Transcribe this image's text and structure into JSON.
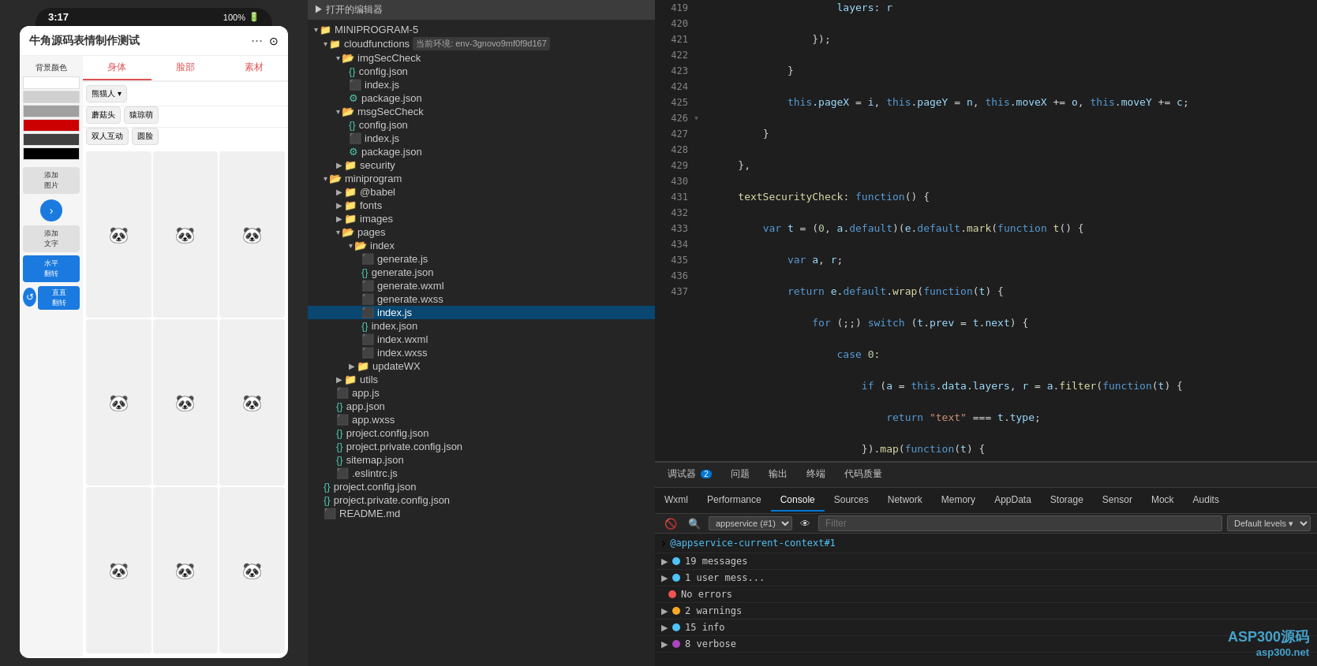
{
  "app": {
    "title": "牛角源码表情制作测试",
    "status_time": "3:17",
    "battery": "100%"
  },
  "phone": {
    "header_title": "牛角源码表情制作测试",
    "dots": "···",
    "record_icon": "⊙",
    "tabs": [
      "身体",
      "脸部",
      "素材"
    ],
    "bg_color_label": "背景颜色",
    "action_btns": [
      "添加图片",
      "添加文字",
      "水平翻转",
      "直直翻转"
    ],
    "dropdown_items": [
      "熊猫人",
      "蘑菇头",
      "猿琼萌",
      "双人互动",
      "圆脸"
    ]
  },
  "file_tree": {
    "open_editor_label": "▶ 打开的编辑器",
    "project_name": "MINIPROGRAM-5",
    "cloudfunctions_label": "cloudfunctions",
    "cloud_env": "当前环境: env-3gnovo9mf0f9d167",
    "items": [
      {
        "name": "imgSecCheck",
        "type": "folder",
        "indent": 2
      },
      {
        "name": "config.json",
        "type": "json",
        "indent": 3
      },
      {
        "name": "index.js",
        "type": "js",
        "indent": 3
      },
      {
        "name": "package.json",
        "type": "json",
        "indent": 3
      },
      {
        "name": "msgSecCheck",
        "type": "folder",
        "indent": 2
      },
      {
        "name": "config.json",
        "type": "json",
        "indent": 3
      },
      {
        "name": "index.js",
        "type": "js",
        "indent": 3
      },
      {
        "name": "package.json",
        "type": "json",
        "indent": 3
      },
      {
        "name": "security",
        "type": "folder",
        "indent": 2
      },
      {
        "name": "miniprogram",
        "type": "folder",
        "indent": 1
      },
      {
        "name": "@babel",
        "type": "folder",
        "indent": 2
      },
      {
        "name": "fonts",
        "type": "folder",
        "indent": 2
      },
      {
        "name": "images",
        "type": "folder",
        "indent": 2
      },
      {
        "name": "pages",
        "type": "folder",
        "indent": 2
      },
      {
        "name": "index",
        "type": "folder",
        "indent": 3
      },
      {
        "name": "generate.js",
        "type": "js",
        "indent": 4
      },
      {
        "name": "generate.json",
        "type": "json",
        "indent": 4
      },
      {
        "name": "generate.wxml",
        "type": "wxml",
        "indent": 4
      },
      {
        "name": "generate.wxss",
        "type": "wxss",
        "indent": 4
      },
      {
        "name": "index.js",
        "type": "js",
        "indent": 4,
        "active": true
      },
      {
        "name": "index.json",
        "type": "json",
        "indent": 4
      },
      {
        "name": "index.wxml",
        "type": "wxml",
        "indent": 4
      },
      {
        "name": "index.wxss",
        "type": "wxss",
        "indent": 4
      },
      {
        "name": "updateWX",
        "type": "folder",
        "indent": 3
      },
      {
        "name": "utils",
        "type": "folder",
        "indent": 2
      },
      {
        "name": "app.js",
        "type": "js",
        "indent": 1
      },
      {
        "name": "app.json",
        "type": "json",
        "indent": 1
      },
      {
        "name": "app.wxss",
        "type": "wxss",
        "indent": 1
      },
      {
        "name": "project.config.json",
        "type": "json",
        "indent": 1
      },
      {
        "name": "project.private.config.json",
        "type": "json",
        "indent": 1
      },
      {
        "name": "sitemap.json",
        "type": "json",
        "indent": 1
      },
      {
        "name": ".eslintrc.js",
        "type": "js_dot",
        "indent": 1
      },
      {
        "name": "project.config.json",
        "type": "json",
        "indent": 0
      },
      {
        "name": "project.private.config.json",
        "type": "json",
        "indent": 0
      },
      {
        "name": "README.md",
        "type": "md",
        "indent": 0
      }
    ]
  },
  "code": {
    "lines": [
      419,
      420,
      421,
      422,
      423,
      424,
      425,
      426,
      427,
      428,
      429,
      430,
      431,
      432,
      433,
      434,
      435,
      436,
      437
    ]
  },
  "console": {
    "tabs": [
      {
        "label": "调试器",
        "badge": "2",
        "active": false
      },
      {
        "label": "问题",
        "badge": "",
        "active": false
      },
      {
        "label": "输出",
        "badge": "",
        "active": false
      },
      {
        "label": "终端",
        "badge": "",
        "active": false
      },
      {
        "label": "代码质量",
        "badge": "",
        "active": false
      }
    ],
    "tab_items": [
      "Wxml",
      "Performance",
      "Console",
      "Sources",
      "Network",
      "Memory",
      "AppData",
      "Storage",
      "Sensor",
      "Mock",
      "Audits"
    ],
    "active_tab": "Console",
    "context": "appservice (#1)",
    "filter_placeholder": "Filter",
    "levels": "Default levels",
    "link": "@appservice-current-context#1",
    "messages": [
      {
        "type": "group",
        "icon": "▶",
        "text": "19 messages",
        "dot": "blue"
      },
      {
        "type": "group",
        "icon": "▶",
        "text": "1 user mess...",
        "dot": "blue"
      },
      {
        "type": "error",
        "icon": "",
        "text": "No errors",
        "dot": "red"
      },
      {
        "type": "warning",
        "icon": "▶",
        "text": "2 warnings",
        "dot": "orange"
      },
      {
        "type": "info",
        "icon": "▶",
        "text": "15 info",
        "dot": "blue"
      },
      {
        "type": "verbose",
        "icon": "▶",
        "text": "8 verbose",
        "dot": "purple"
      }
    ]
  },
  "watermark": {
    "line1": "ASP300源码",
    "line2": "asp300.net"
  }
}
